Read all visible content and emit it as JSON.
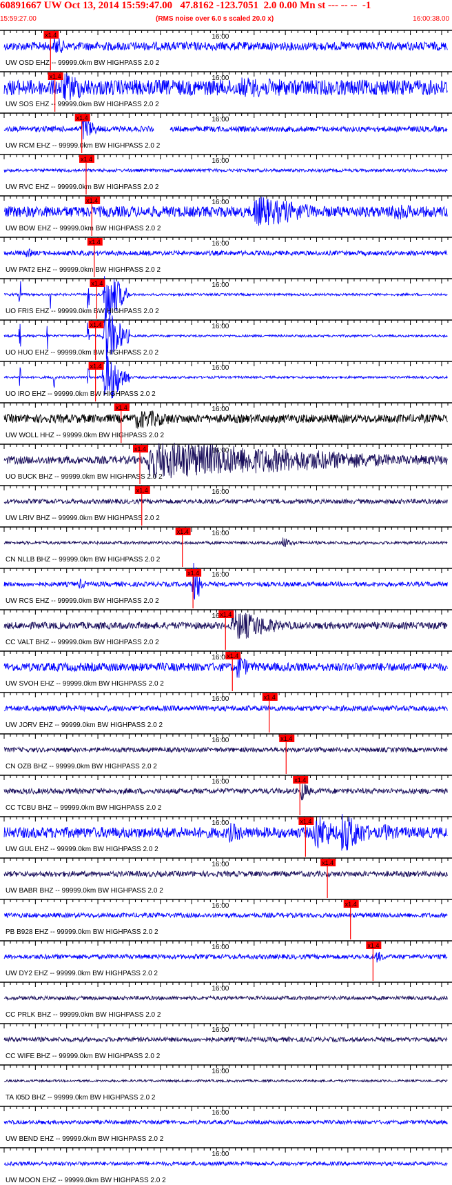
{
  "header": {
    "title": "60891667 UW Oct 13, 2014 15:59:47.00   47.8162 -123.7051  2.0 0.00 Mn st --- -- --  -1",
    "start_time": "15:59:27.00",
    "note": "(RMS noise over 6.0 s scaled 20.0 x)",
    "end_time": "16:00:38.00"
  },
  "chart_data": {
    "type": "seismogram_stack",
    "x_range": [
      "15:59:27.00",
      "16:00:38.00"
    ],
    "x_tick_label": "16:00",
    "pick_label": "x1.4",
    "colors": {
      "header": "#ff0000",
      "pick": "#ff0000",
      "trace_blue": "#0000ff",
      "trace_dark": "#1a0f5c",
      "trace_black": "#000000",
      "separator": "#000000"
    },
    "traces": [
      {
        "label": "UW OSD EHZ -- 99999.0km BW  HIGHPASS  2.0  2",
        "pick": "15:59:34.2",
        "color": "blue",
        "amplitude": 0.22,
        "events": [
          {
            "t": "15:59:35.0",
            "amp": 0.55,
            "dur": 3
          }
        ]
      },
      {
        "label": "UW SOS EHZ -- 99999.0km BW  HIGHPASS  2.0  2",
        "pick": "15:59:34.9",
        "color": "blue",
        "amplitude": 0.4,
        "events": [
          {
            "t": "15:59:36.0",
            "amp": 0.85,
            "dur": 8
          },
          {
            "t": "16:00:05.0",
            "amp": 0.55,
            "dur": 25
          }
        ]
      },
      {
        "label": "UW RCM EHZ -- 99999.0km BW  HIGHPASS  2.0  2",
        "pick": "15:59:39.2",
        "color": "blue",
        "amplitude": 0.14,
        "gap": [
          "15:59:51.0",
          "15:59:53.5"
        ],
        "events": [
          {
            "t": "15:59:39.5",
            "amp": 0.7,
            "dur": 3
          }
        ]
      },
      {
        "label": "UW RVC EHZ -- 99999.0km BW  HIGHPASS  2.0  2",
        "pick": "15:59:39.9",
        "color": "blue",
        "amplitude": 0.08,
        "events": []
      },
      {
        "label": "UW BOW EHZ -- 99999.0km BW  HIGHPASS  2.0  2",
        "pick": "15:59:40.8",
        "color": "blue",
        "amplitude": 0.28,
        "events": [
          {
            "t": "16:00:07.0",
            "amp": 0.85,
            "dur": 14
          },
          {
            "t": "16:00:29.0",
            "amp": 0.5,
            "dur": 8
          }
        ]
      },
      {
        "label": "UW PAT2 EHZ -- 99999.0km BW  HIGHPASS  2.0  2",
        "pick": "15:59:41.2",
        "color": "blue",
        "amplitude": 0.12,
        "events": [
          {
            "t": "15:59:30.5",
            "amp": 0.3,
            "dur": 2
          }
        ]
      },
      {
        "label": "UO FRIS EHZ -- 99999.0km BW  HIGHPASS  2.0  2",
        "pick": "15:59:41.6",
        "color": "blue",
        "amplitude": 0.06,
        "events": [
          {
            "t": "15:59:43.0",
            "amp": 1.6,
            "dur": 4
          }
        ],
        "spikes": [
          "15:59:29.5",
          "15:59:34.5",
          "15:59:40.5"
        ]
      },
      {
        "label": "UO HUO EHZ -- 99999.0km BW  HIGHPASS  2.0  2",
        "pick": "15:59:41.4",
        "color": "blue",
        "amplitude": 0.06,
        "events": [
          {
            "t": "15:59:43.0",
            "amp": 1.6,
            "dur": 4
          }
        ],
        "spikes": [
          "15:59:29.5",
          "15:59:34.0",
          "15:59:40.5"
        ]
      },
      {
        "label": "UO IRO EHZ -- 99999.0km BW  HIGHPASS  2.0  2",
        "pick": "15:59:41.4",
        "color": "blue",
        "amplitude": 0.06,
        "events": [
          {
            "t": "15:59:43.0",
            "amp": 1.6,
            "dur": 4
          }
        ],
        "spikes": [
          "15:59:29.5",
          "15:59:35.0",
          "15:59:40.5"
        ]
      },
      {
        "label": "UW WOLL HHZ -- 99999.0km BW  HIGHPASS  2.0  2",
        "pick": "15:59:45.5",
        "color": "black",
        "amplitude": 0.22,
        "events": [
          {
            "t": "15:59:48.0",
            "amp": 0.55,
            "dur": 10
          }
        ]
      },
      {
        "label": "UO BUCK BHZ -- 99999.0km BW  HIGHPASS  2.0  2",
        "pick": "15:59:48.5",
        "color": "dark",
        "amplitude": 0.2,
        "events": [
          {
            "t": "15:59:50.0",
            "amp": 1.0,
            "dur": 50
          }
        ]
      },
      {
        "label": "UW LRIV BHZ -- 99999.0km BW  HIGHPASS  2.0  2",
        "pick": "15:59:48.8",
        "color": "dark",
        "amplitude": 0.12,
        "events": []
      },
      {
        "label": "CN NLLB BHZ -- 99999.0km BW  HIGHPASS  2.0  2",
        "pick": "15:59:55.3",
        "color": "dark",
        "amplitude": 0.08,
        "events": [
          {
            "t": "16:00:11.5",
            "amp": 0.35,
            "dur": 2
          }
        ]
      },
      {
        "label": "UW RCS EHZ -- 99999.0km BW  HIGHPASS  2.0  2",
        "pick": "15:59:57.0",
        "color": "blue",
        "amplitude": 0.12,
        "events": [
          {
            "t": "15:59:57.3",
            "amp": 1.4,
            "dur": 1.5
          },
          {
            "t": "15:59:39.0",
            "amp": 0.3,
            "dur": 2
          }
        ]
      },
      {
        "label": "CC VALT BHZ -- 99999.0km BW  HIGHPASS  2.0  2",
        "pick": "16:00:02.2",
        "color": "dark",
        "amplitude": 0.18,
        "events": [
          {
            "t": "16:00:03.5",
            "amp": 0.85,
            "dur": 10
          }
        ]
      },
      {
        "label": "UW SVOH EHZ -- 99999.0km BW  HIGHPASS  2.0  2",
        "pick": "16:00:03.3",
        "color": "blue",
        "amplitude": 0.22,
        "events": [
          {
            "t": "16:00:04.2",
            "amp": 0.75,
            "dur": 3
          }
        ]
      },
      {
        "label": "UW JORV EHZ -- 99999.0km BW  HIGHPASS  2.0  2",
        "pick": "16:00:09.2",
        "color": "blue",
        "amplitude": 0.14,
        "events": []
      },
      {
        "label": "CN OZB BHZ -- 99999.0km BW  HIGHPASS  2.0  2",
        "pick": "16:00:11.9",
        "color": "dark",
        "amplitude": 0.12,
        "events": []
      },
      {
        "label": "CC TCBU BHZ -- 99999.0km BW  HIGHPASS  2.0  2",
        "pick": "16:00:14.1",
        "color": "dark",
        "amplitude": 0.14,
        "events": [
          {
            "t": "16:00:14.5",
            "amp": 0.6,
            "dur": 2
          }
        ]
      },
      {
        "label": "UW GUL EHZ -- 99999.0km BW  HIGHPASS  2.0  2",
        "pick": "16:00:15.0",
        "color": "blue",
        "amplitude": 0.28,
        "events": [
          {
            "t": "16:00:03.0",
            "amp": 0.55,
            "dur": 5
          },
          {
            "t": "16:00:16.5",
            "amp": 1.1,
            "dur": 5
          },
          {
            "t": "16:00:21.0",
            "amp": 1.1,
            "dur": 6
          },
          {
            "t": "16:00:27.5",
            "amp": 0.5,
            "dur": 5
          }
        ]
      },
      {
        "label": "UW BABR BHZ -- 99999.0km BW  HIGHPASS  2.0  2",
        "pick": "16:00:18.5",
        "color": "dark",
        "amplitude": 0.14,
        "events": []
      },
      {
        "label": "PB B928 EHZ -- 99999.0km BW  HIGHPASS  2.0  2",
        "pick": "16:00:22.2",
        "color": "blue",
        "amplitude": 0.12,
        "events": []
      },
      {
        "label": "UW DY2 EHZ -- 99999.0km BW  HIGHPASS  2.0  2",
        "pick": "16:00:25.8",
        "color": "blue",
        "amplitude": 0.12,
        "events": [
          {
            "t": "16:00:26.5",
            "amp": 0.35,
            "dur": 2
          }
        ]
      },
      {
        "label": "CC PRLK BHZ -- 99999.0km BW  HIGHPASS  2.0  2",
        "pick": null,
        "color": "dark",
        "amplitude": 0.1,
        "events": []
      },
      {
        "label": "CC WIFE BHZ -- 99999.0km BW  HIGHPASS  2.0  2",
        "pick": null,
        "color": "dark",
        "amplitude": 0.12,
        "events": []
      },
      {
        "label": "TA I05D BHZ -- 99999.0km BW  HIGHPASS  2.0  2",
        "pick": null,
        "color": "dark",
        "amplitude": 0.06,
        "events": []
      },
      {
        "label": "UW BEND EHZ -- 99999.0km BW  HIGHPASS  2.0  2",
        "pick": null,
        "color": "blue",
        "amplitude": 0.1,
        "events": []
      },
      {
        "label": "UW MOON EHZ -- 99999.0km BW  HIGHPASS  2.0  2",
        "pick": null,
        "color": "blue",
        "amplitude": 0.1,
        "events": []
      }
    ]
  }
}
